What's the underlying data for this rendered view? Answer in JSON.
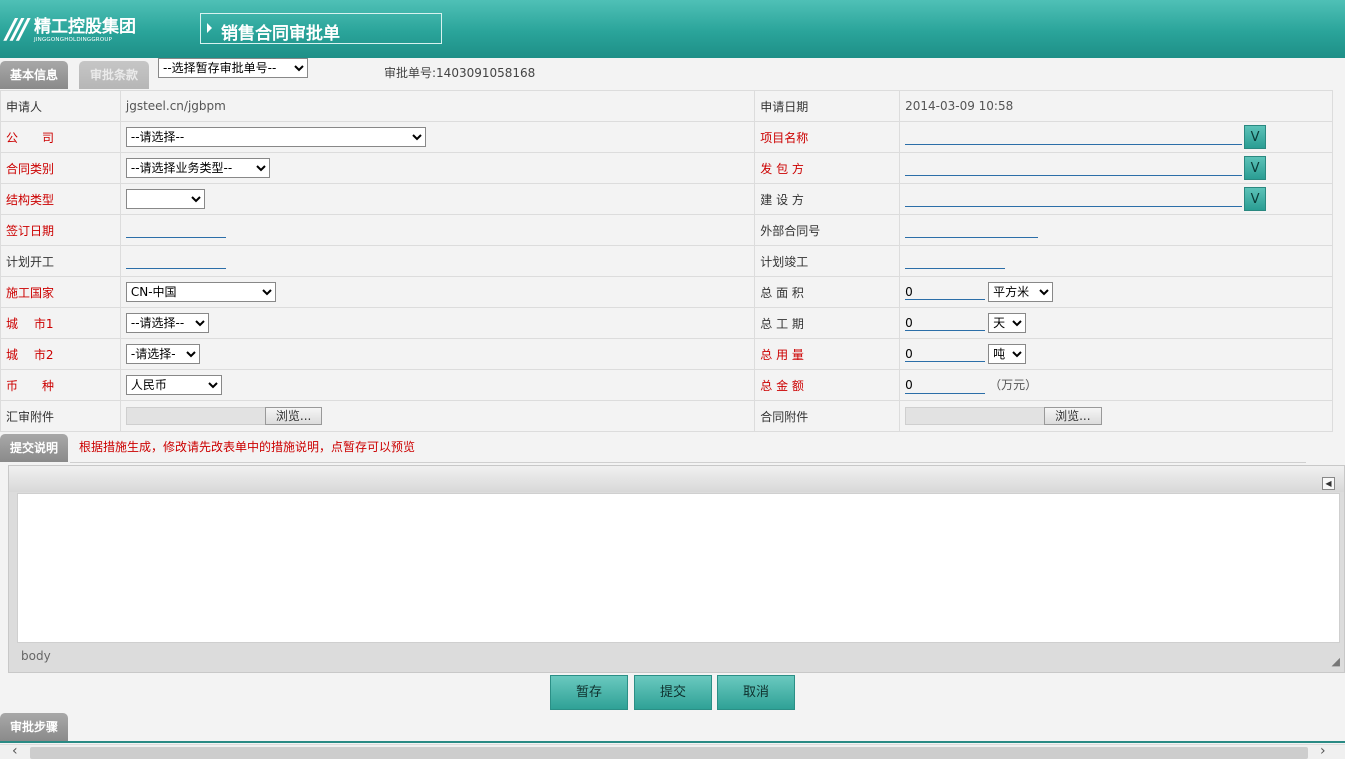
{
  "header": {
    "logo_cn": "精工控股集团",
    "logo_en": "JINGGONGHOLDINGGROUP",
    "title": "销售合同审批单"
  },
  "tabs": {
    "basic_info": "基本信息",
    "approval_terms": "审批条款"
  },
  "draft_select": {
    "value": "--选择暂存审批单号--"
  },
  "approval_number": "审批单号:1403091058168",
  "form": {
    "applicant_label": "申请人",
    "applicant_value": "jgsteel.cn/jgbpm",
    "apply_date_label": "申请日期",
    "apply_date_value": "2014-03-09 10:58",
    "company_label": "公　　司",
    "company_value": "--请选择--",
    "project_label": "项目名称",
    "contract_type_label": "合同类别",
    "contract_type_value": "--请选择业务类型--",
    "contractor_label": "发 包 方",
    "structure_label": "结构类型",
    "structure_value": "",
    "builder_label": "建 设 方",
    "sign_date_label": "签订日期",
    "ext_contract_label": "外部合同号",
    "plan_start_label": "计划开工",
    "plan_finish_label": "计划竣工",
    "country_label": "施工国家",
    "country_value": "CN-中国",
    "total_area_label": "总 面 积",
    "total_area_value": "0",
    "area_unit": "平方米",
    "city1_label": "城　 市1",
    "city1_value": "--请选择--",
    "total_period_label": "总 工 期",
    "total_period_value": "0",
    "period_unit": "天",
    "city2_label": "城　 市2",
    "city2_value": "-请选择-",
    "total_usage_label": "总 用 量",
    "total_usage_value": "0",
    "usage_unit": "吨",
    "currency_label": "币　　种",
    "currency_value": "人民币",
    "total_amount_label": "总 金 额",
    "total_amount_value": "0",
    "amount_unit": "（万元）",
    "remit_attach_label": "汇审附件",
    "contract_attach_label": "合同附件",
    "browse_label": "浏览...",
    "v_label": "V"
  },
  "submit_desc": {
    "tab": "提交说明",
    "note": "根据措施生成，修改请先改表单中的措施说明，点暂存可以预览",
    "editor_path": "body"
  },
  "buttons": {
    "save": "暂存",
    "submit": "提交",
    "cancel": "取消"
  },
  "steps_tab": "审批步骤"
}
